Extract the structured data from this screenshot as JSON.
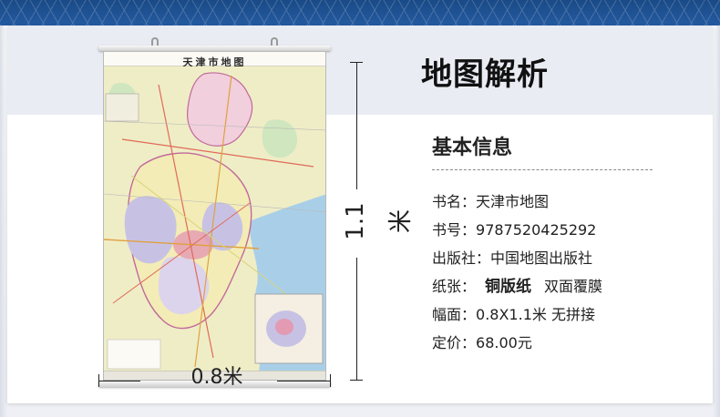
{
  "page": {
    "panel_title": "地图解析",
    "section_title": "基本信息"
  },
  "map": {
    "title": "天津市地图"
  },
  "dimensions": {
    "height_label": "1.1米",
    "width_label": "0.8米"
  },
  "info": {
    "name_label": "书名：",
    "name_value": "天津市地图",
    "isbn_label": "书号：",
    "isbn_value": "9787520425292",
    "publisher_label": "出版社：",
    "publisher_value": "中国地图出版社",
    "paper_label": "纸张：",
    "paper_value": "铜版纸",
    "paper_extra": "双面覆膜",
    "size_label": "幅面：",
    "size_value": "0.8X1.1米 无拼接",
    "price_label": "定价：",
    "price_value": "68.00元"
  },
  "colors": {
    "banner": "#1a4a86",
    "header_band": "#e9ecf3",
    "sea": "#a9cfe8",
    "land_pink": "#f1cfdc",
    "land_yellow": "#f3ecb6",
    "land_purple": "#c7c2e4",
    "land_green": "#cfe6bf"
  }
}
